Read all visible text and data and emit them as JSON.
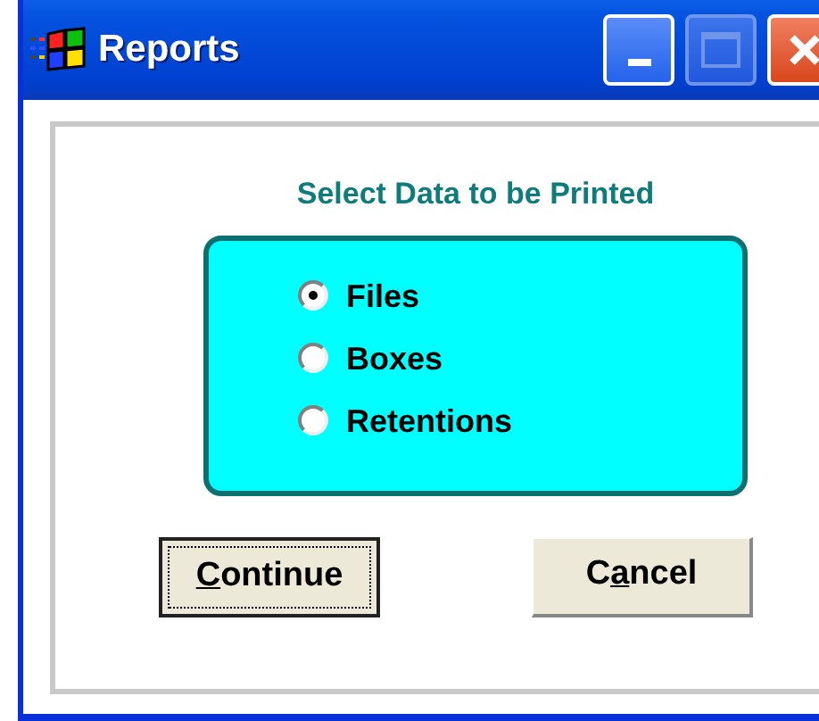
{
  "window": {
    "title": "Reports"
  },
  "group": {
    "heading": "Select Data to be Printed"
  },
  "options": [
    {
      "label": "Files",
      "selected": true
    },
    {
      "label": "Boxes",
      "selected": false
    },
    {
      "label": "Retentions",
      "selected": false
    }
  ],
  "buttons": [
    {
      "key": "C",
      "after": "ontinue",
      "default": true
    },
    {
      "before": "C",
      "key": "a",
      "after": "ncel",
      "default": false
    }
  ]
}
